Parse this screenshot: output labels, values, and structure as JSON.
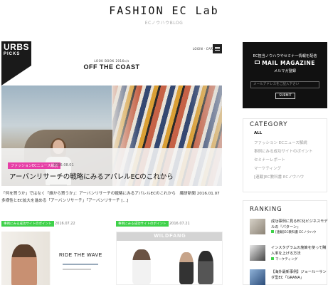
{
  "site": {
    "title": "FASHION EC Lab",
    "tagline": "ECノウハウBLOG"
  },
  "hero": {
    "brand": "URBS",
    "brand_sub": "PICKS",
    "nav": "LOGIN · CART",
    "lookbook": "LOOK BOOK 2016s/s",
    "headline": "OFF THE COAST",
    "category": "ファッションECニュース解説",
    "date": "2016.08.01",
    "title": "アーバンリサーチの戦略にみるアパレルECのこれから"
  },
  "excerpt": "「何を買うか」ではなく「誰から買うか」：アーバンリサーチの戦略にみるアパレルECのこれから　繊研新聞 2016.01.07　多様性とEC拡大を進める「アーバンリサーチ」「アーバンリサーチ […]",
  "cards": [
    {
      "category": "事例にみる成功サイトのポイント",
      "date": "2016.07.22",
      "image_text": "RIDE THE WAVE"
    },
    {
      "category": "事例にみる成功サイトのポイント",
      "date": "2016.07.21",
      "image_text": "WILDFANG"
    }
  ],
  "newsletter": {
    "intro": "EC担当ノウハウやセミナー情報を配信",
    "title": "MAIL MAGAZINE",
    "subtitle": "メルマガ登録",
    "placeholder": "メールアドレスをご記入下さい",
    "button": "SUBMIT"
  },
  "category": {
    "heading": "CATEGORY",
    "items": [
      "ALL",
      "ファッション ECニュース解説",
      "事例にみる成功サイトのポイント",
      "セミナーレポート",
      "マーケティング",
      "[連載]EC教科書 ECノウハウ"
    ]
  },
  "ranking": {
    "heading": "RANKING",
    "items": [
      {
        "title": "成功事例に見るEC化ビジネスモデルの『パターン』",
        "category": "[連載]EC教科書 ECノウハウ"
      },
      {
        "title": "インスタグラムの施策を使って購入率を上げる方法",
        "category": "マーケティング"
      },
      {
        "title": "【海外最新事例】ジョールーサンダ型EC「GRANA」",
        "category": ""
      }
    ]
  }
}
